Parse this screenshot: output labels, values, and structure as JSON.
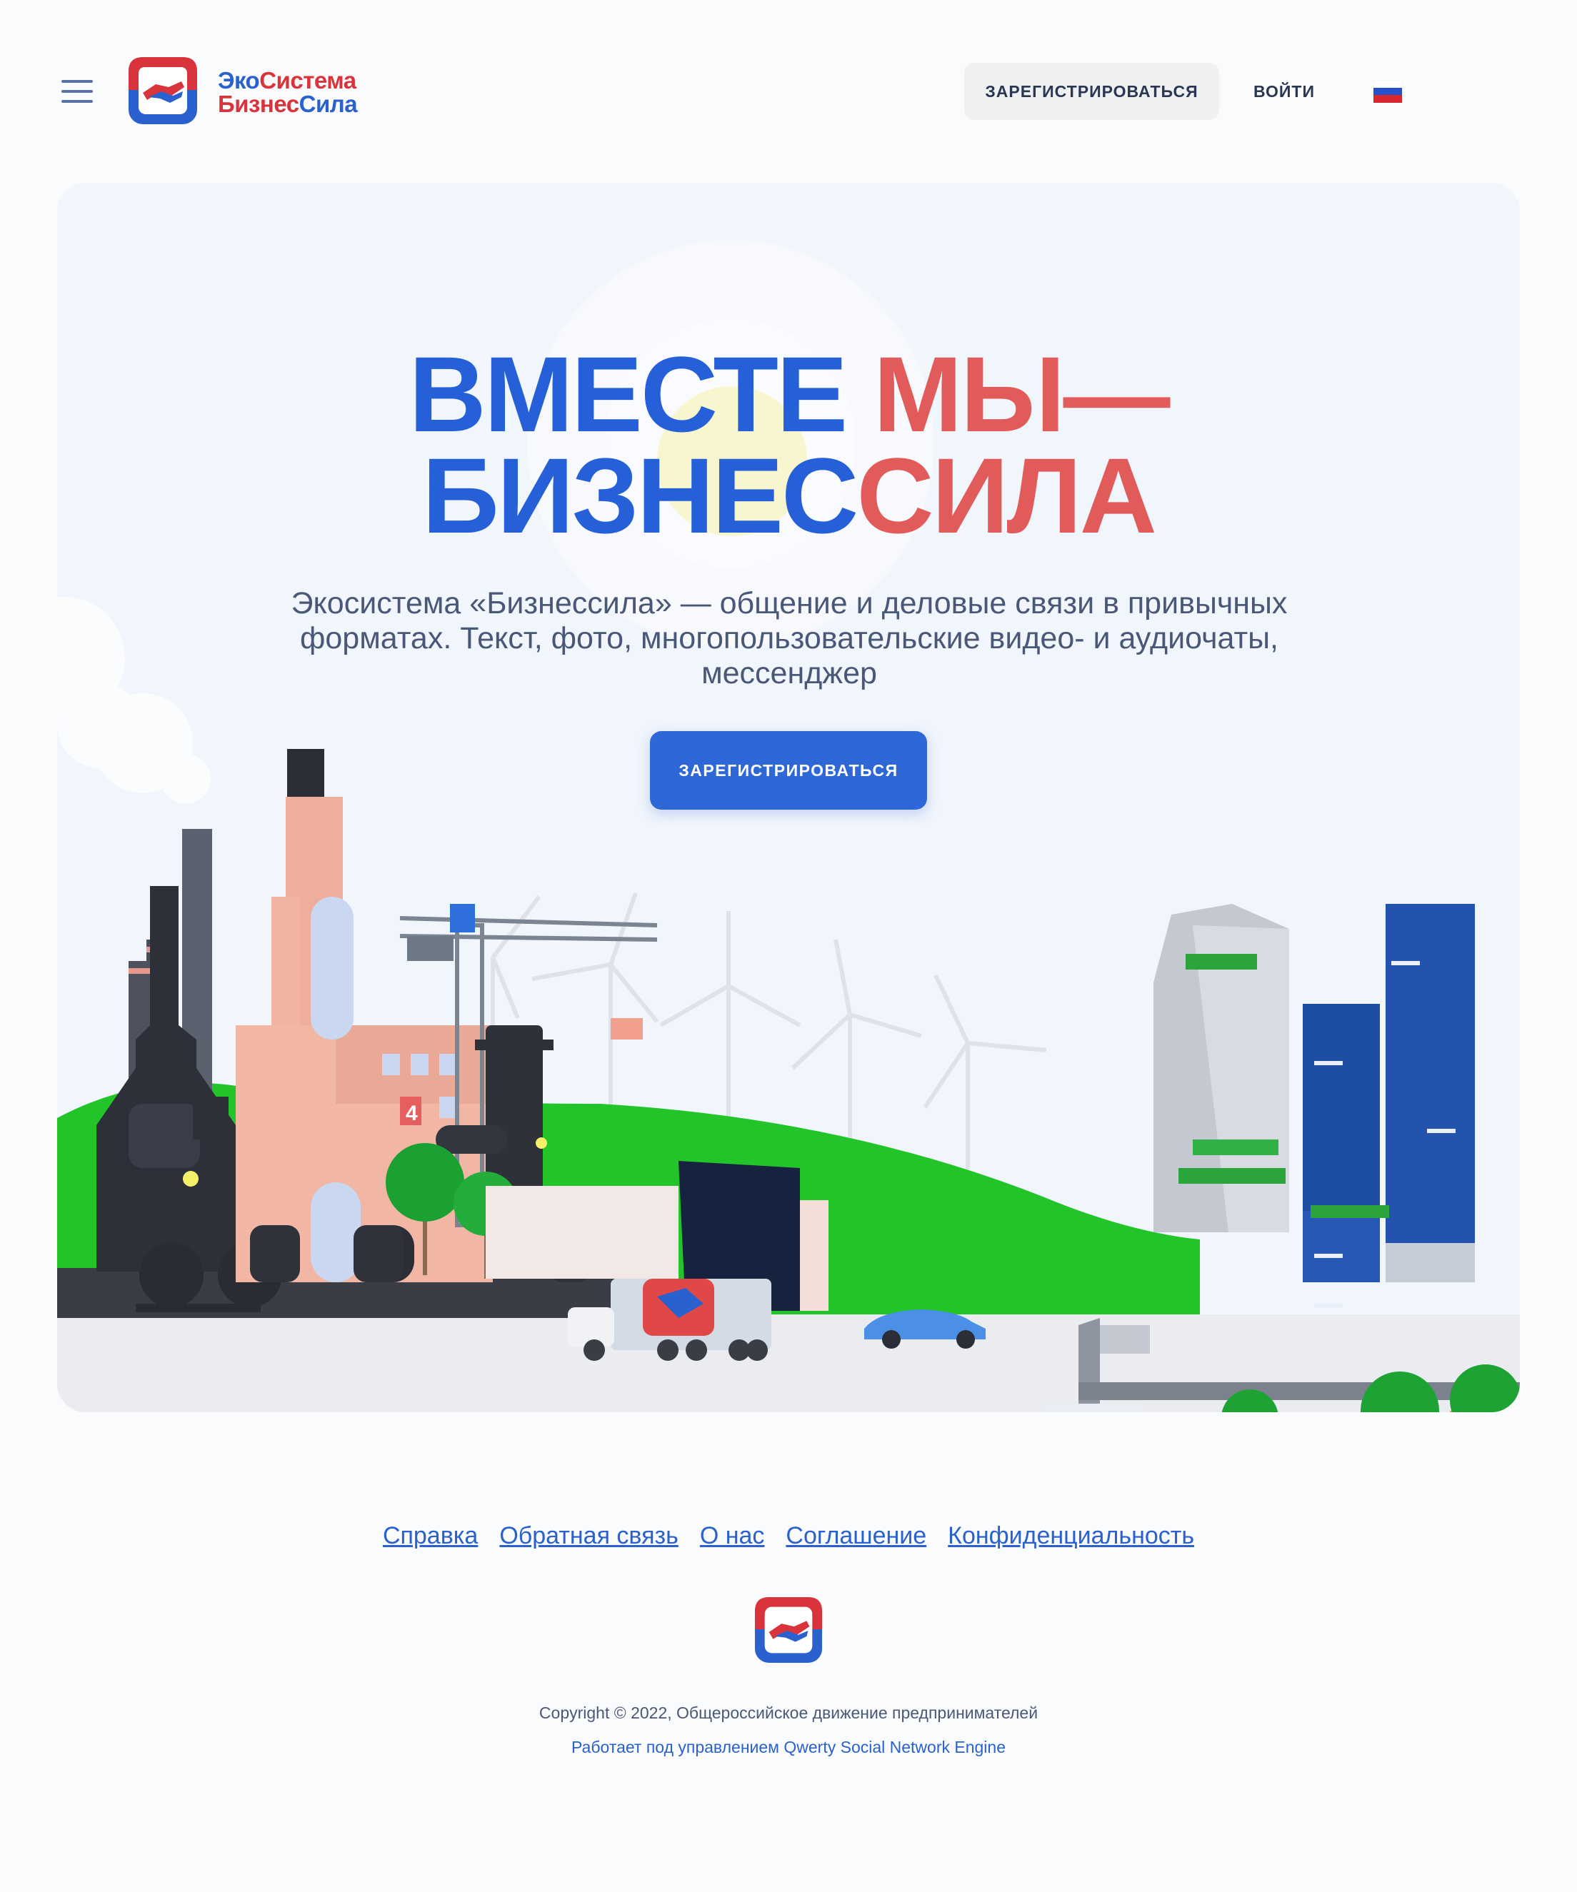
{
  "header": {
    "brand_line1_a": "Эко",
    "brand_line1_b": "Система",
    "brand_line2_a": "Бизнес",
    "brand_line2_b": "Сила",
    "register_label": "ЗАРЕГИСТРИРОВАТЬСЯ",
    "login_label": "ВОЙТИ",
    "language_icon": "russia-flag-icon",
    "menu_icon": "hamburger-menu-icon"
  },
  "hero": {
    "headline_line1_a": "ВМЕСТЕ ",
    "headline_line1_b": "МЫ—",
    "headline_line2_a": "БИЗНЕС",
    "headline_line2_b": "СИЛА",
    "subtitle": "Экосистема «Бизнессила» — общение и деловые связи в привычных форматах. Текст, фото, многопользовательские видео- и аудиочаты, мессенджер",
    "cta_label": "ЗАРЕГИСТРИРОВАТЬСЯ",
    "truck_sign": "4"
  },
  "footer": {
    "links": [
      "Справка",
      "Обратная связь",
      "О нас",
      "Соглашение",
      "Конфиденциальность"
    ],
    "copyright": "Copyright © 2022, Общероссийское движение предпринимателей",
    "powered_by": "Работает под управлением Qwerty Social Network Engine"
  },
  "colors": {
    "brand_blue": "#2660d8",
    "brand_red": "#e25b5b",
    "hero_background": "#f1f5fc",
    "grass_green": "#22c42a"
  }
}
